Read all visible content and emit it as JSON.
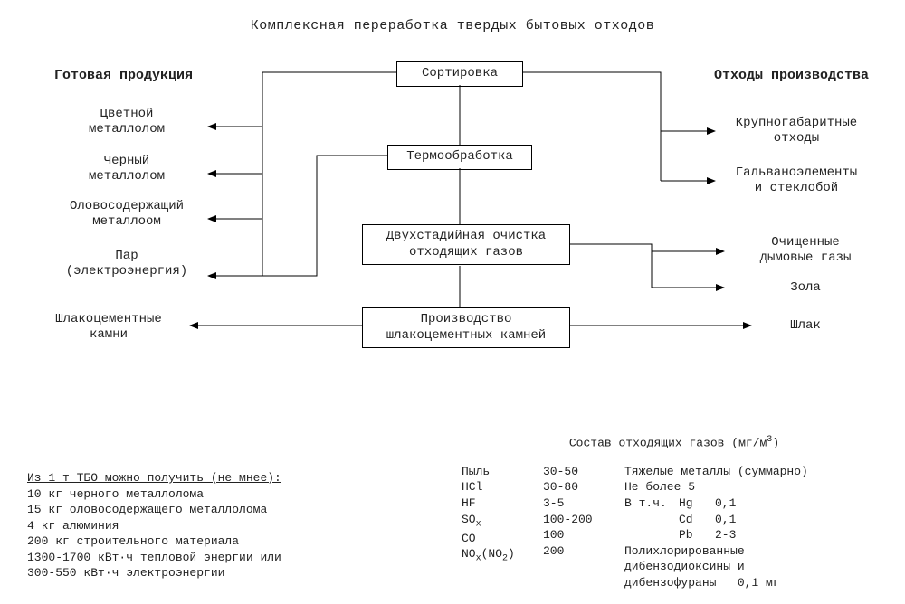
{
  "title": "Комплексная переработка твердых бытовых отходов",
  "columns": {
    "left_header": "Готовая продукция",
    "right_header": "Отходы производства"
  },
  "process_boxes": {
    "sort": "Сортировка",
    "thermo": "Термообработка",
    "cleaning_l1": "Двухстадийная очистка",
    "cleaning_l2": "отходящих газов",
    "slag_l1": "Производство",
    "slag_l2": "шлакоцементных камней"
  },
  "left_items": {
    "nonferrous_l1": "Цветной",
    "nonferrous_l2": "металлолом",
    "ferrous_l1": "Черный",
    "ferrous_l2": "металлолом",
    "tin_l1": "Оловосодержащий",
    "tin_l2": "металлоом",
    "steam_l1": "Пар",
    "steam_l2": "(электроэнергия)",
    "stones_l1": "Шлакоцементные",
    "stones_l2": "камни"
  },
  "right_items": {
    "bulky_l1": "Крупногабаритные",
    "bulky_l2": "отходы",
    "galv_l1": "Гальваноэлементы",
    "galv_l2": "и стеклобой",
    "clean_gas_l1": "Очищенные",
    "clean_gas_l2": "дымовые газы",
    "ash": "Зола",
    "slag": "Шлак"
  },
  "yield_block": {
    "header": "Из 1 т ТБО можно получить (не мнее):",
    "lines": [
      "10 кг черного металлолома",
      "15 кг оловосодержащего металлолома",
      "4 кг алюминия",
      "200 кг строительного материала",
      "1300-1700 кВт·ч тепловой энергии или",
      "300-550 кВт·ч электроэнергии"
    ]
  },
  "gas_block": {
    "title_pre": "Состав отходящих газов (мг/м",
    "title_sup": "3",
    "title_post": ")",
    "rows": [
      {
        "name": "Пыль",
        "value": "30-50"
      },
      {
        "name": "HCl",
        "value": "30-80"
      },
      {
        "name": "HF",
        "value": "3-5"
      },
      {
        "name": "SOx_html",
        "value": "100-200"
      },
      {
        "name": "CO",
        "value": "100"
      },
      {
        "name": "NOx_html",
        "value": "200"
      }
    ],
    "heavy_metals": {
      "label": "Тяжелые металлы (суммарно)",
      "limit": "Не более 5",
      "in_that": "В т.ч.",
      "items": [
        {
          "el": "Hg",
          "val": "0,1"
        },
        {
          "el": "Cd",
          "val": "0,1"
        },
        {
          "el": "Pb",
          "val": "2-3"
        }
      ],
      "pcdd_l1": "Полихлорированные",
      "pcdd_l2": "дибензодиоксины и",
      "pcdd_l3_label": "дибензофураны",
      "pcdd_l3_val": "0,1 мг"
    }
  }
}
